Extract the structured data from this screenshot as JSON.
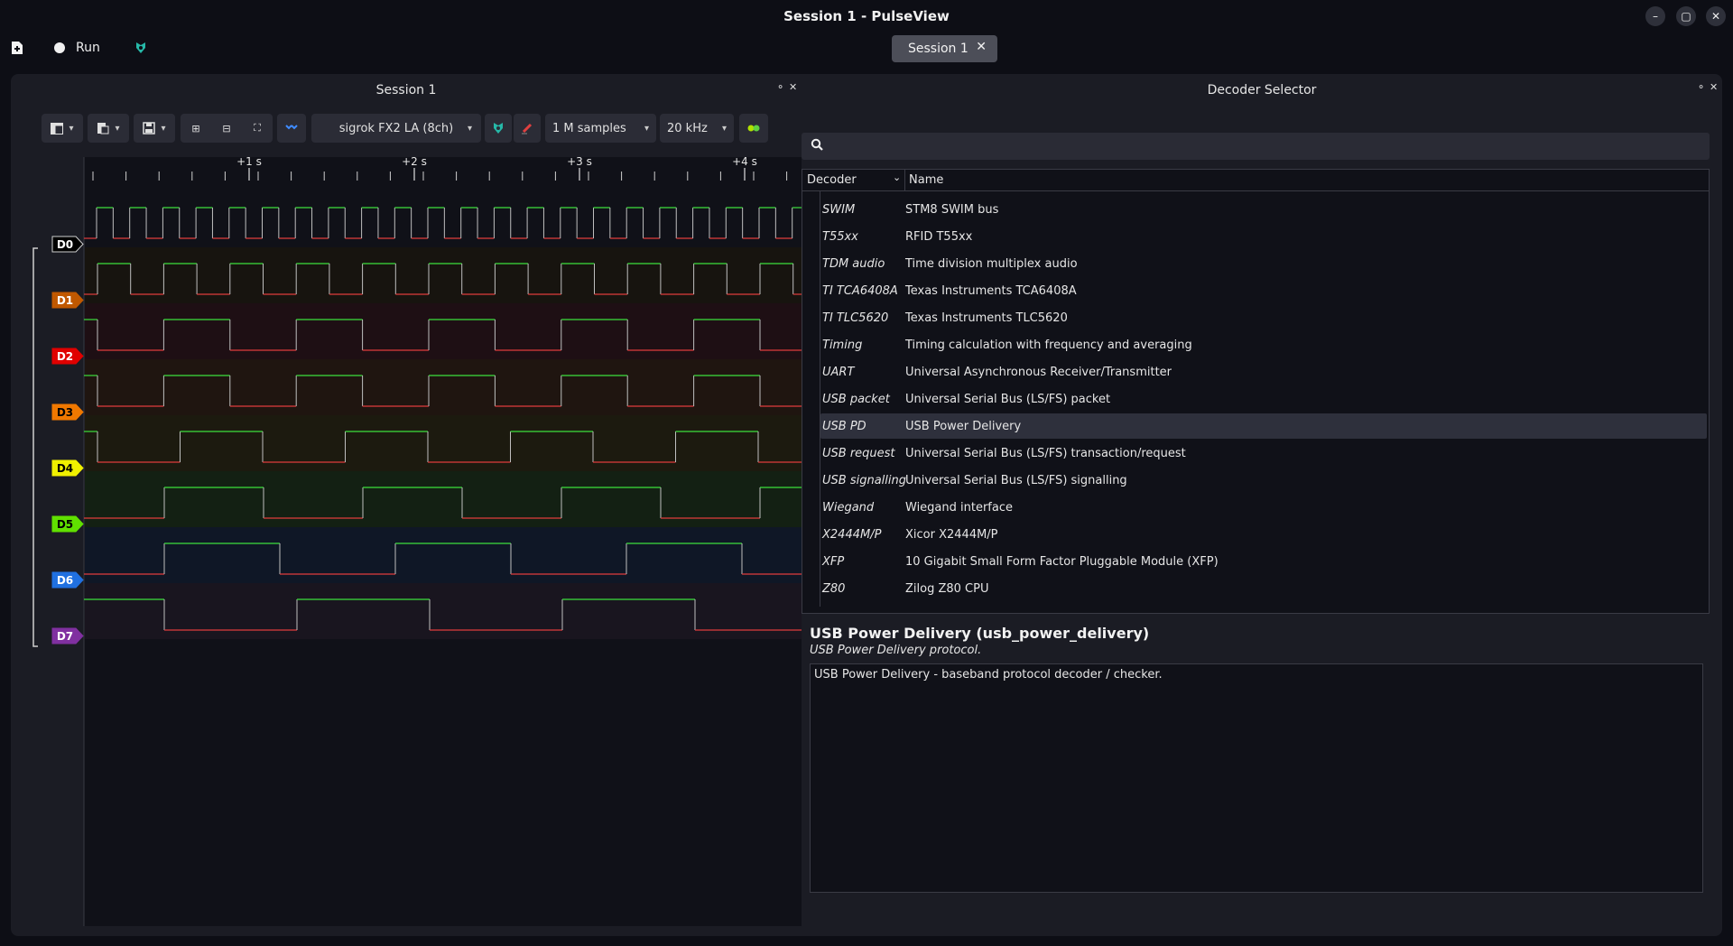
{
  "window": {
    "title": "Session 1 - PulseView"
  },
  "toolbar": {
    "run_label": "Run"
  },
  "tabs": [
    {
      "label": "Session 1"
    }
  ],
  "session": {
    "title": "Session 1",
    "device": "sigrok FX2 LA (8ch)",
    "samples": "1 M samples",
    "rate": "20 kHz"
  },
  "ruler": {
    "ticks": [
      "+1 s",
      "+2 s",
      "+3 s",
      "+4 s"
    ]
  },
  "channels": [
    {
      "name": "D0",
      "color": "#000000",
      "text": "#ffffff",
      "bg": "#101118"
    },
    {
      "name": "D1",
      "color": "#c05800",
      "text": "#ffffff",
      "bg": "#17140f"
    },
    {
      "name": "D2",
      "color": "#e00000",
      "text": "#ffffff",
      "bg": "#1e0f14"
    },
    {
      "name": "D3",
      "color": "#f07800",
      "text": "#000000",
      "bg": "#1f1510"
    },
    {
      "name": "D4",
      "color": "#f0f000",
      "text": "#000000",
      "bg": "#1c1a0f"
    },
    {
      "name": "D5",
      "color": "#60e000",
      "text": "#000000",
      "bg": "#132013"
    },
    {
      "name": "D6",
      "color": "#2070e0",
      "text": "#ffffff",
      "bg": "#0f1726"
    },
    {
      "name": "D7",
      "color": "#8030a0",
      "text": "#ffffff",
      "bg": "#19151f"
    }
  ],
  "decoder_selector": {
    "title": "Decoder Selector",
    "search_placeholder": "",
    "columns": [
      "Decoder",
      "Name"
    ],
    "rows": [
      {
        "id": "SWIM",
        "name": "STM8 SWIM bus"
      },
      {
        "id": "T55xx",
        "name": "RFID T55xx"
      },
      {
        "id": "TDM audio",
        "name": "Time division multiplex audio"
      },
      {
        "id": "TI TCA6408A",
        "name": "Texas Instruments TCA6408A"
      },
      {
        "id": "TI TLC5620",
        "name": "Texas Instruments TLC5620"
      },
      {
        "id": "Timing",
        "name": "Timing calculation with frequency and averaging"
      },
      {
        "id": "UART",
        "name": "Universal Asynchronous Receiver/Transmitter"
      },
      {
        "id": "USB packet",
        "name": "Universal Serial Bus (LS/FS) packet"
      },
      {
        "id": "USB PD",
        "name": "USB Power Delivery"
      },
      {
        "id": "USB request",
        "name": "Universal Serial Bus (LS/FS) transaction/request"
      },
      {
        "id": "USB signalling",
        "name": "Universal Serial Bus (LS/FS) signalling"
      },
      {
        "id": "Wiegand",
        "name": "Wiegand interface"
      },
      {
        "id": "X2444M/P",
        "name": "Xicor X2444M/P"
      },
      {
        "id": "XFP",
        "name": "10 Gigabit Small Form Factor Pluggable Module (XFP)"
      },
      {
        "id": "Z80",
        "name": "Zilog Z80 CPU"
      }
    ],
    "selected_index": 8,
    "detail": {
      "title": "USB Power Delivery (usb_power_delivery)",
      "subtitle": "USB Power Delivery protocol.",
      "description": "USB Power Delivery - baseband protocol decoder / checker."
    }
  },
  "colors": {
    "wave_high": "#3ce03c",
    "wave_low": "#e03c3c",
    "wave_edge": "#bfbfbf"
  }
}
